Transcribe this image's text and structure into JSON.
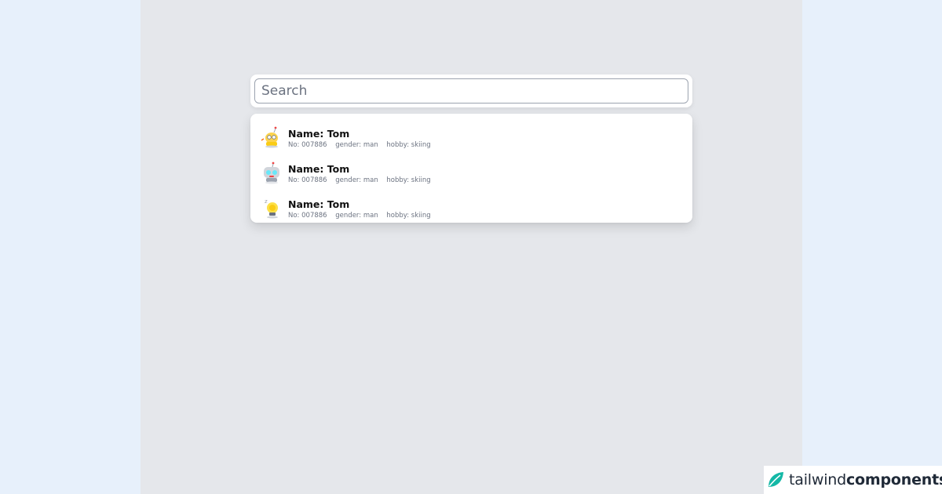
{
  "search": {
    "placeholder": "Search",
    "value": ""
  },
  "results": [
    {
      "avatar_icon": "yellow-robot-icon",
      "name": "Name: Tom",
      "no": "No: 007886",
      "gender": "gender: man",
      "hobby": "hobby: skiing"
    },
    {
      "avatar_icon": "blue-robot-icon",
      "name": "Name: Tom",
      "no": "No: 007886",
      "gender": "gender: man",
      "hobby": "hobby: skiing"
    },
    {
      "avatar_icon": "lightbulb-robot-icon",
      "name": "Name: Tom",
      "no": "No: 007886",
      "gender": "gender: man",
      "hobby": "hobby: skiing"
    }
  ],
  "brand": {
    "name_light": "tailwind",
    "name_bold": "components",
    "logo_icon": "leaf-icon",
    "color": "#14b8a6"
  }
}
